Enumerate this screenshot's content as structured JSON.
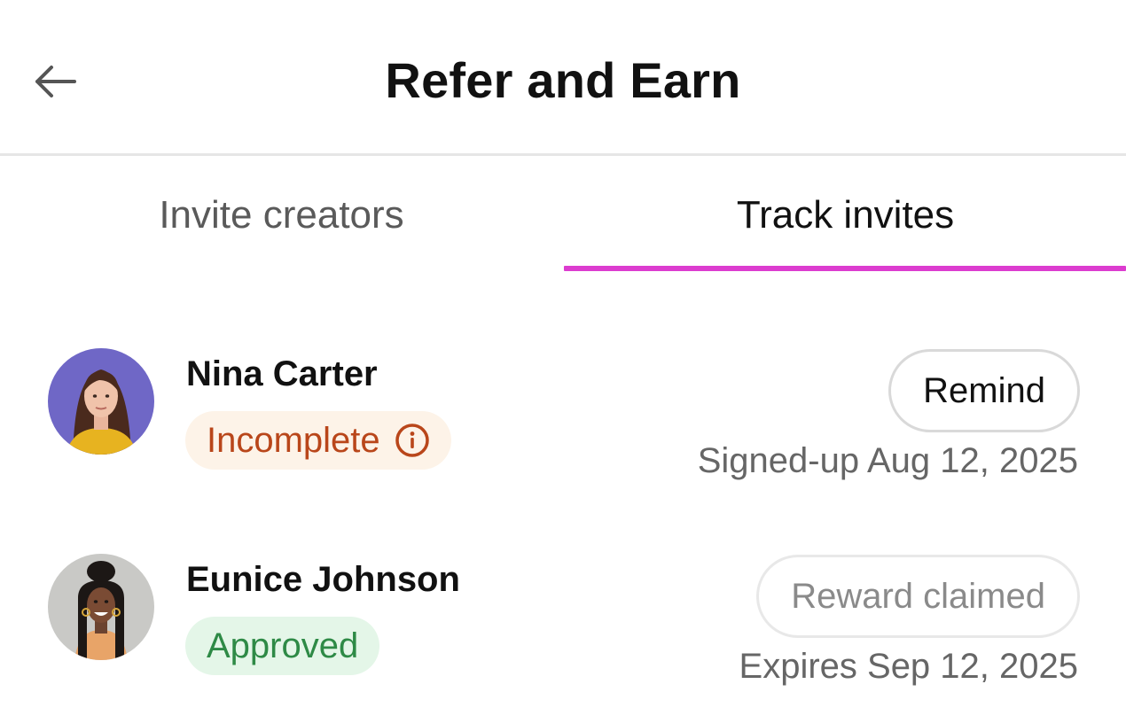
{
  "header": {
    "title": "Refer and Earn",
    "back_icon": "arrow-left-icon"
  },
  "tabs": [
    {
      "label": "Invite creators",
      "active": false
    },
    {
      "label": "Track invites",
      "active": true
    }
  ],
  "colors": {
    "tab_indicator": "#dc3ccf",
    "incomplete_bg": "#fdf3e8",
    "incomplete_text": "#b9461a",
    "approved_bg": "#e4f6e8",
    "approved_text": "#2e8a46"
  },
  "invites": [
    {
      "name": "Nina Carter",
      "avatar_icon": "avatar-photo",
      "status": "Incomplete",
      "status_icon": "info-circle-icon",
      "action_label": "Remind",
      "meta": "Signed-up Aug 12, 2025"
    },
    {
      "name": "Eunice Johnson",
      "avatar_icon": "avatar-photo",
      "status": "Approved",
      "action_label": "Reward claimed",
      "meta": "Expires Sep 12, 2025"
    }
  ]
}
